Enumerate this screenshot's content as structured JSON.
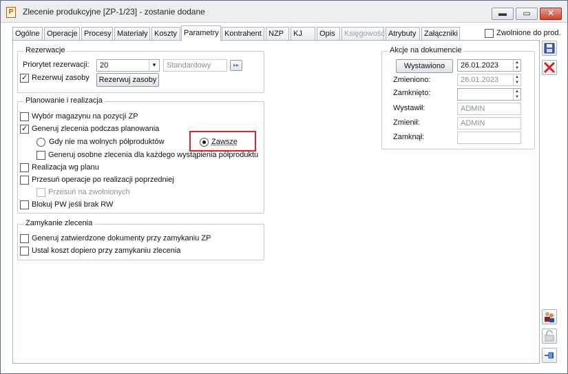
{
  "window": {
    "title": "Zlecenie produkcyjne  [ZP-1/23] - zostanie dodane",
    "minimize": "▬",
    "maximize": "▭",
    "close": "✕"
  },
  "tabs": [
    "Ogólne",
    "Operacje",
    "Procesy",
    "Materiały",
    "Koszty",
    "Parametry",
    "Kontrahent",
    "NZP",
    "KJ",
    "Opis",
    "Księgowość",
    "Atrybuty",
    "Załączniki"
  ],
  "active_tab": "Parametry",
  "zwolnione_label": "Zwolnione do prod.",
  "rezerwacje": {
    "title": "Rezerwacje",
    "priorytet_label": "Priorytet rezerwacji:",
    "priorytet_value": "20",
    "priorytet_name": "Standardowy",
    "rezerwuj_checkbox_label": "Rezerwuj zasoby",
    "rezerwuj_button": "Rezerwuj zasoby"
  },
  "planowanie": {
    "title": "Planowanie i realizacja",
    "wybor_magazynu": "Wybór magazynu na pozycji ZP",
    "generuj_zlecenia": "Generuj zlecenia podczas planowania",
    "radio_gdy": "Gdy nie ma wolnych półproduktów",
    "radio_zawsze": "Zawsze",
    "generuj_osobne": "Generuj osobne zlecenia dla każdego wystąpienia półproduktu",
    "realizacja_wg_planu": "Realizacja wg planu",
    "przesun_operacje": "Przesuń operacje po realizacji poprzedniej",
    "przesun_zwolnionych": "Przesuń na zwolnionych",
    "blokuj_pw": "Blokuj PW jeśli brak RW"
  },
  "zamykanie": {
    "title": "Zamykanie zlecenia",
    "generuj_zatwierdzone": "Generuj zatwierdzone dokumenty przy zamykaniu ZP",
    "ustal_koszt": "Ustal koszt dopiero przy zamykaniu zlecenia"
  },
  "akcje": {
    "title": "Akcje na dokumencie",
    "wystawiono_button": "Wystawiono",
    "wystawiono_date": "26.01.2023",
    "zmieniono_label": "Zmieniono:",
    "zmieniono_date": "26.01.2023",
    "zamknieto_label": "Zamknięto:",
    "zamknieto_date": "",
    "wystawil_label": "Wystawił:",
    "wystawil_value": "ADMIN",
    "zmienil_label": "Zmienił:",
    "zmienil_value": "ADMIN",
    "zamknal_label": "Zamknął:",
    "zamknal_value": ""
  },
  "colors": {
    "highlight_border": "#e0202a",
    "save_icon": "#3a5fa8",
    "delete_icon": "#d42020"
  }
}
